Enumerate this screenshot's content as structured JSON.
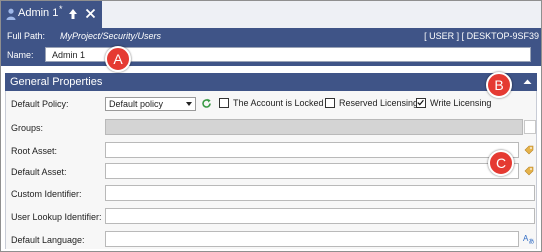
{
  "tab": {
    "title": "Admin 1",
    "modified_marker": "*"
  },
  "path": {
    "label": "Full Path:",
    "value": "MyProject/Security/Users",
    "right_text": "[ USER ] [ DESKTOP-9SF39"
  },
  "name": {
    "label": "Name:",
    "value": "Admin 1"
  },
  "section": {
    "title": "General Properties"
  },
  "form": {
    "default_policy": {
      "label": "Default Policy:",
      "value": "Default policy"
    },
    "checkboxes": [
      {
        "label": "The Account is Locked",
        "checked": false
      },
      {
        "label": "Reserved Licensing",
        "checked": false
      },
      {
        "label": "Write Licensing",
        "checked": true
      }
    ],
    "groups": {
      "label": "Groups:"
    },
    "root_asset": {
      "label": "Root Asset:"
    },
    "default_asset": {
      "label": "Default Asset:"
    },
    "custom_identifier": {
      "label": "Custom Identifier:"
    },
    "user_lookup_identifier": {
      "label": "User Lookup Identifier:"
    },
    "default_language": {
      "label": "Default Language:"
    }
  },
  "annotations": {
    "a": "A",
    "b": "B",
    "c": "C"
  },
  "colors": {
    "header_blue": "#3f5487",
    "badge_red": "#e53a32"
  },
  "icons": [
    "user-icon",
    "pin-icon",
    "close-icon",
    "collapse-chevron-icon",
    "refresh-icon",
    "tag-icon",
    "language-icon",
    "check-icon"
  ]
}
